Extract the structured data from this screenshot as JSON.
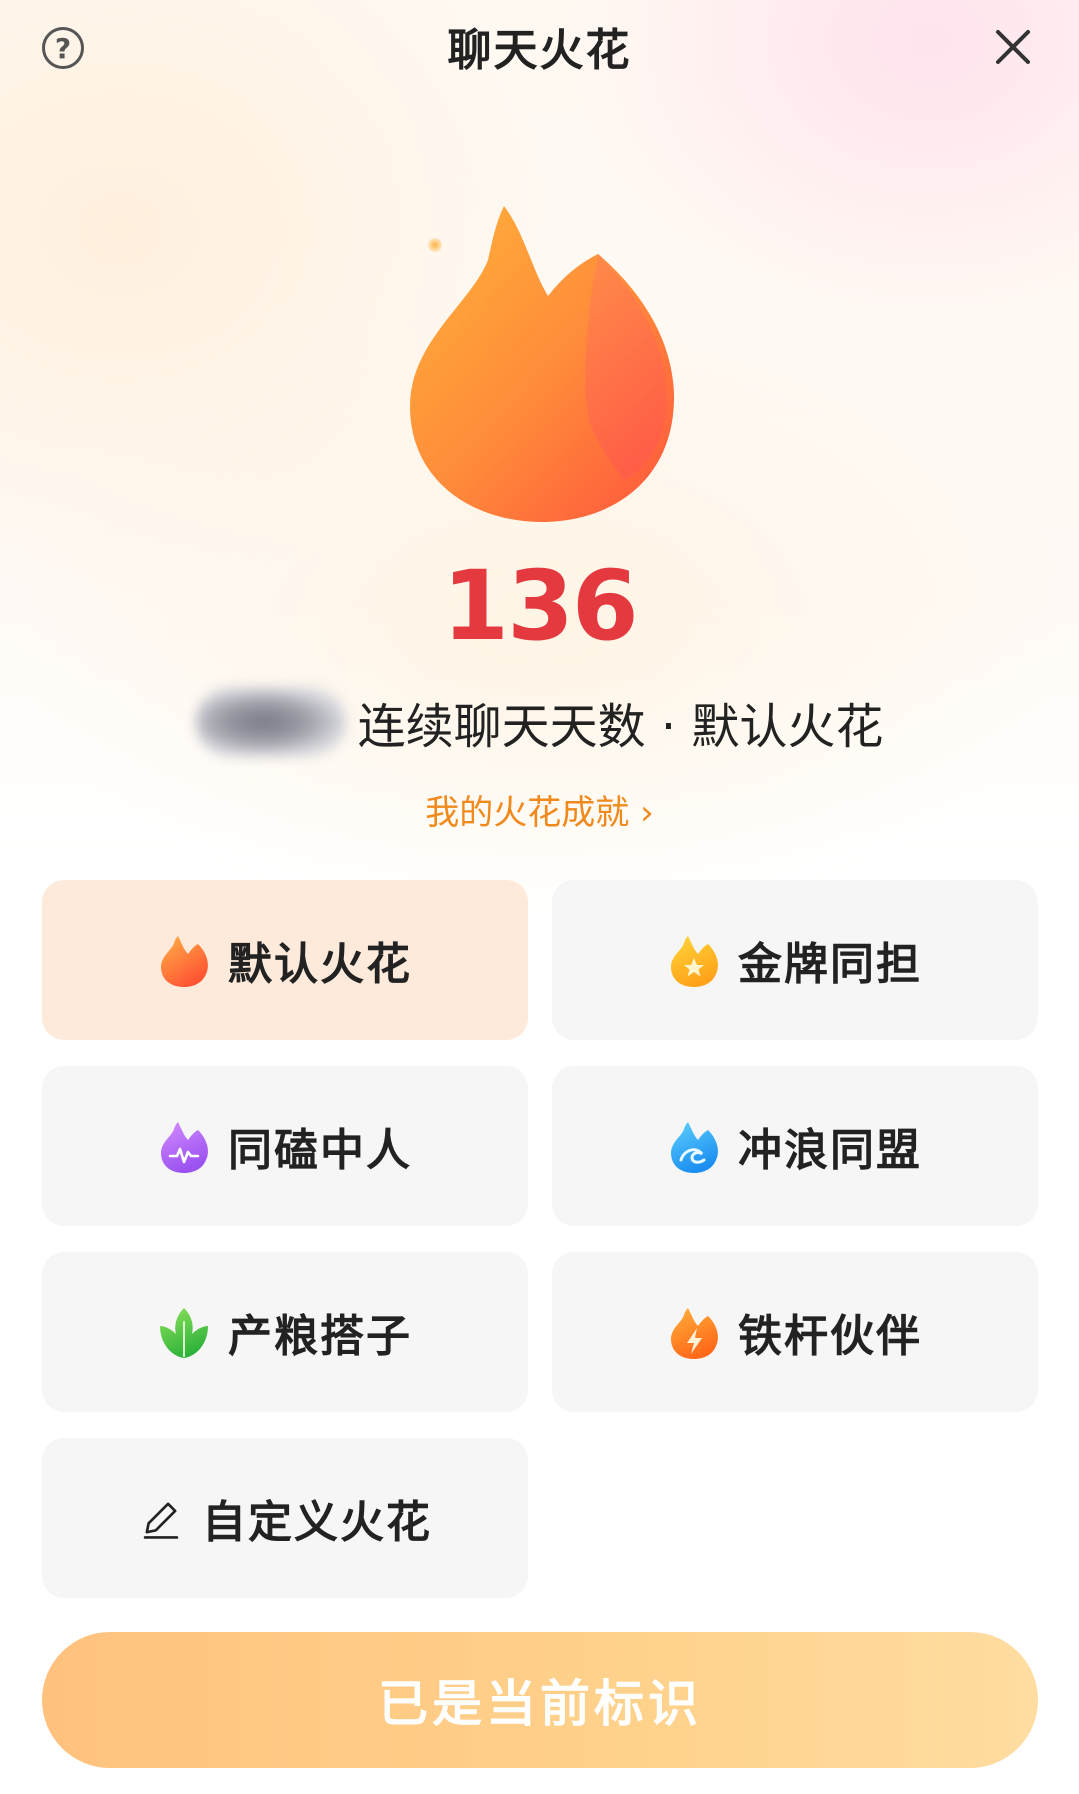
{
  "header": {
    "title": "聊天火花",
    "help_icon": "question-circle-icon",
    "help_glyph": "?",
    "close_icon": "close-icon"
  },
  "hero": {
    "flame_icon": "flame-icon",
    "day_count": "136",
    "subtitle": "连续聊天天数 · 默认火花",
    "achievements_link": "我的火花成就",
    "chevron": "›"
  },
  "spark_options": [
    {
      "label": "默认火花",
      "icon": "flame-orange-icon",
      "selected": true
    },
    {
      "label": "金牌同担",
      "icon": "flame-gold-star-icon",
      "selected": false
    },
    {
      "label": "同磕中人",
      "icon": "flame-purple-heartbeat-icon",
      "selected": false
    },
    {
      "label": "冲浪同盟",
      "icon": "flame-blue-wave-icon",
      "selected": false
    },
    {
      "label": "产粮搭子",
      "icon": "flame-green-leaf-icon",
      "selected": false
    },
    {
      "label": "铁杆伙伴",
      "icon": "flame-orange-lightning-icon",
      "selected": false
    },
    {
      "label": "自定义火花",
      "icon": "pencil-icon",
      "selected": false
    }
  ],
  "action_button": {
    "label": "已是当前标识"
  },
  "colors": {
    "count_red": "#e4393e",
    "link_orange": "#f08a1c",
    "selected_card_bg": "#fdeadb",
    "card_bg": "#f6f6f6",
    "button_gradient_start": "#ffc27e",
    "button_gradient_end": "#ffdca0"
  }
}
